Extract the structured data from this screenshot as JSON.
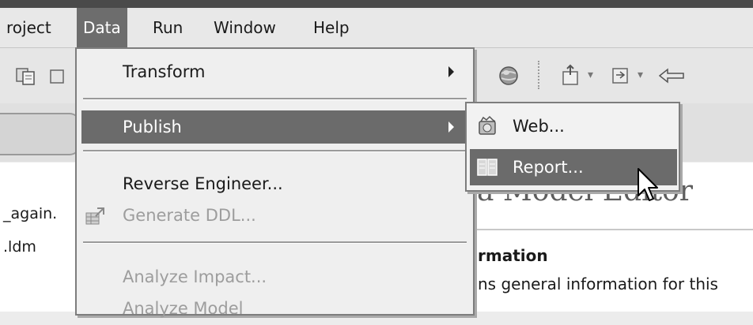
{
  "menubar": {
    "items": [
      {
        "label": "roject"
      },
      {
        "label": "Data"
      },
      {
        "label": "Run"
      },
      {
        "label": "Window"
      },
      {
        "label": "Help"
      }
    ]
  },
  "toolbar": {
    "icons": [
      "project-icon",
      "project-icon-2",
      "globe-icon",
      "export-icon",
      "nav-icon",
      "back-arrow-icon"
    ]
  },
  "data_menu": {
    "items": [
      {
        "label": "Transform",
        "has_submenu": true,
        "enabled": true
      },
      {
        "label": "Publish",
        "has_submenu": true,
        "enabled": true,
        "highlighted": true
      },
      {
        "label": "Reverse Engineer...",
        "enabled": true
      },
      {
        "label": "Generate DDL...",
        "enabled": false,
        "icon": "generate-ddl-icon"
      },
      {
        "label": "Analyze Impact...",
        "enabled": false
      },
      {
        "label": "Analyze Model",
        "enabled": false
      }
    ]
  },
  "publish_submenu": {
    "items": [
      {
        "label": "Web...",
        "icon": "web-icon"
      },
      {
        "label": "Report...",
        "icon": "report-icon",
        "highlighted": true
      }
    ]
  },
  "project_tree": {
    "items": [
      {
        "label": "_again."
      },
      {
        "label": ".ldm"
      }
    ]
  },
  "editor": {
    "title": "a Model Editor",
    "section_title": "rmation",
    "section_desc": "ns general information for this"
  },
  "colors": {
    "highlight": "#6b6b6b",
    "menu_bg": "#efefef",
    "disabled_text": "#9d9d9d"
  }
}
